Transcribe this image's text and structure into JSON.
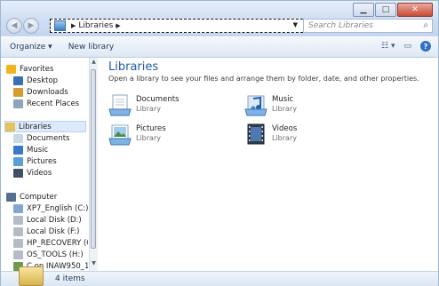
{
  "address": {
    "crumb": "Libraries",
    "search_placeholder": "Search Libraries"
  },
  "toolbar": {
    "organize": "Organize ▾",
    "new_library": "New library"
  },
  "nav": {
    "items": [
      {
        "label": "Favorites",
        "icon": "star-icon",
        "color": "#f2b51d"
      },
      {
        "label": "Desktop",
        "icon": "desktop-icon",
        "color": "#3b6fb3"
      },
      {
        "label": "Downloads",
        "icon": "downloads-icon",
        "color": "#d79c2e"
      },
      {
        "label": "Recent Places",
        "icon": "recent-places-icon",
        "color": "#8ea3bd"
      },
      {
        "label": "Libraries",
        "icon": "libraries-icon",
        "color": "#e7c15a"
      },
      {
        "label": "Documents",
        "icon": "documents-icon",
        "color": "#c9d6e6"
      },
      {
        "label": "Music",
        "icon": "music-icon",
        "color": "#3c78c9"
      },
      {
        "label": "Pictures",
        "icon": "pictures-icon",
        "color": "#5aa0d6"
      },
      {
        "label": "Videos",
        "icon": "videos-icon",
        "color": "#3e4f66"
      },
      {
        "label": "Computer",
        "icon": "computer-icon",
        "color": "#546d90"
      },
      {
        "label": "XP7_English (C:)",
        "icon": "drive-c-icon",
        "color": "#7fa7d1"
      },
      {
        "label": "Local Disk (D:)",
        "icon": "drive-icon",
        "color": "#b5bcc6"
      },
      {
        "label": "Local Disk (F:)",
        "icon": "drive-icon",
        "color": "#b5bcc6"
      },
      {
        "label": "HP_RECOVERY (G:)",
        "icon": "drive-icon",
        "color": "#b5bcc6"
      },
      {
        "label": "OS_TOOLS (H:)",
        "icon": "drive-icon",
        "color": "#b5bcc6"
      },
      {
        "label": "C on INAW950_1",
        "icon": "network-drive-icon",
        "color": "#6e9a4d"
      }
    ]
  },
  "main": {
    "title": "Libraries",
    "subtitle": "Open a library to see your files and arrange them by folder, date, and other properties.",
    "libraries": [
      {
        "name": "Documents",
        "type": "Library",
        "icon": "documents-library-icon"
      },
      {
        "name": "Music",
        "type": "Library",
        "icon": "music-library-icon"
      },
      {
        "name": "Pictures",
        "type": "Library",
        "icon": "pictures-library-icon"
      },
      {
        "name": "Videos",
        "type": "Library",
        "icon": "videos-library-icon"
      }
    ]
  },
  "status": {
    "count": "4 items"
  },
  "colors": {
    "accent": "#1e5aa8",
    "selection": "#dceafc"
  }
}
